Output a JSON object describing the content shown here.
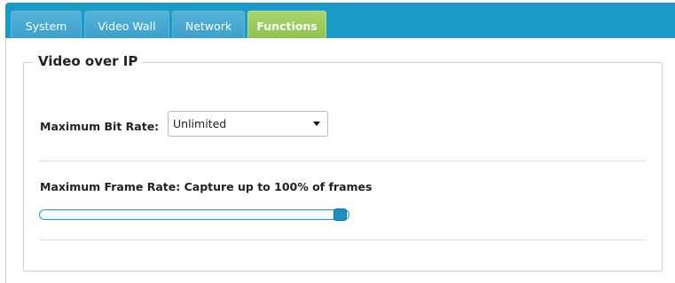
{
  "tabs": [
    {
      "label": "System",
      "active": false
    },
    {
      "label": "Video Wall",
      "active": false
    },
    {
      "label": "Network",
      "active": false
    },
    {
      "label": "Functions",
      "active": true
    }
  ],
  "colors": {
    "tab_bar": "#1a9ac6",
    "active_tab": "#9ccb5c",
    "slider": "#1c8fc3"
  },
  "video_over_ip": {
    "legend": "Video over IP",
    "max_bit_rate": {
      "label": "Maximum Bit Rate:",
      "value": "Unlimited",
      "icon": "chevron-down-icon"
    },
    "max_frame_rate": {
      "label": "Maximum Frame Rate: Capture up to 100% of frames",
      "value_percent": 100
    }
  }
}
